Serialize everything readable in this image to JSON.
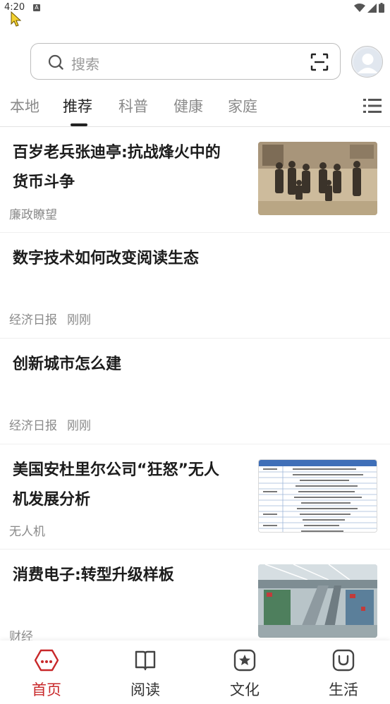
{
  "status_bar": {
    "time": "4:20",
    "notif": "A"
  },
  "search": {
    "placeholder": "搜索"
  },
  "tabs": [
    {
      "label": "本地",
      "active": false
    },
    {
      "label": "推荐",
      "active": true
    },
    {
      "label": "科普",
      "active": false
    },
    {
      "label": "健康",
      "active": false
    },
    {
      "label": "家庭",
      "active": false
    }
  ],
  "feed": [
    {
      "title_lines": [
        "百岁老兵张迪亭:抗战烽火中的",
        "货币斗争"
      ],
      "source": "廉政瞭望",
      "time": "",
      "thumb": "vintage-group-photo"
    },
    {
      "title_lines": [
        "数字技术如何改变阅读生态"
      ],
      "source": "经济日报",
      "time": "刚刚",
      "thumb": ""
    },
    {
      "title_lines": [
        "创新城市怎么建"
      ],
      "source": "经济日报",
      "time": "刚刚",
      "thumb": ""
    },
    {
      "title_lines": [
        "美国安杜里尔公司“狂怒”无人",
        "机发展分析"
      ],
      "source": "无人机",
      "time": "",
      "thumb": "product-table"
    },
    {
      "title_lines": [
        "消费电子:转型升级样板"
      ],
      "source": "财经",
      "time": "",
      "thumb": "electronics-mall"
    }
  ],
  "bottom_nav": [
    {
      "label": "首页",
      "icon": "home-hex-icon",
      "active": true
    },
    {
      "label": "阅读",
      "icon": "book-icon",
      "active": false
    },
    {
      "label": "文化",
      "icon": "star-badge-icon",
      "active": false
    },
    {
      "label": "生活",
      "icon": "smile-bag-icon",
      "active": false
    }
  ],
  "colors": {
    "accent": "#c8282a",
    "text": "#1c1c1c",
    "muted": "#8a8a8a"
  }
}
